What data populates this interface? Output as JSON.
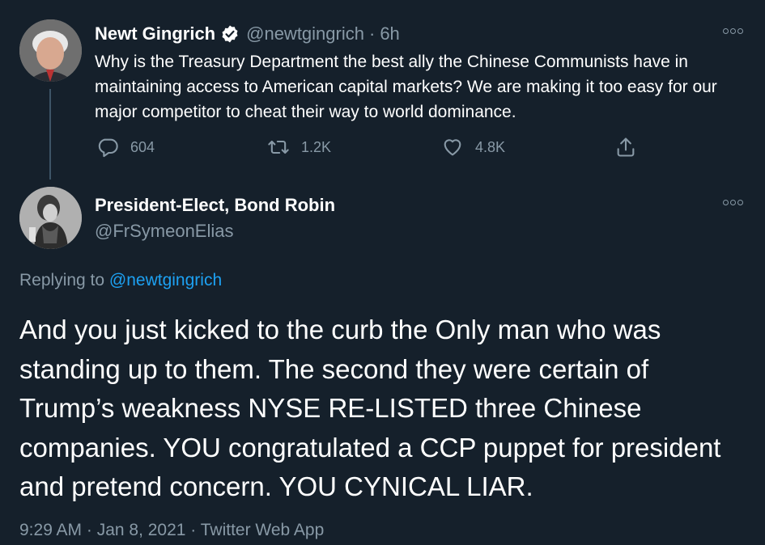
{
  "original_tweet": {
    "author_name": "Newt Gingrich",
    "verified": true,
    "handle": "@newtgingrich",
    "separator": "·",
    "time": "6h",
    "text": "Why is the Treasury Department the best ally the Chinese Communists have in maintaining access to American capital markets? We are making it too easy for our major competitor to cheat their way to world dominance.",
    "replies": "604",
    "retweets": "1.2K",
    "likes": "4.8K"
  },
  "reply_tweet": {
    "author_name": "President-Elect, Bond Robin",
    "handle": "@FrSymeonElias",
    "replying_prefix": "Replying to",
    "replying_to": "@newtgingrich",
    "text": "And you just kicked to the curb the Only man who was standing up to them. The second they were certain of Trump’s weakness NYSE RE-LISTED three Chinese companies. YOU congratulated a CCP puppet for president and pretend concern. YOU CYNICAL LIAR.",
    "timestamp": "9:29 AM · Jan 8, 2021 · Twitter Web App"
  },
  "colors": {
    "background": "#15202b",
    "text_primary": "#ffffff",
    "text_secondary": "#8899a6",
    "link": "#1da1f2",
    "thread_line": "#3d5466"
  },
  "icons": {
    "reply": "reply-icon",
    "retweet": "retweet-icon",
    "like": "heart-icon",
    "share": "share-icon",
    "more": "more-icon",
    "verified": "verified-badge-icon"
  }
}
